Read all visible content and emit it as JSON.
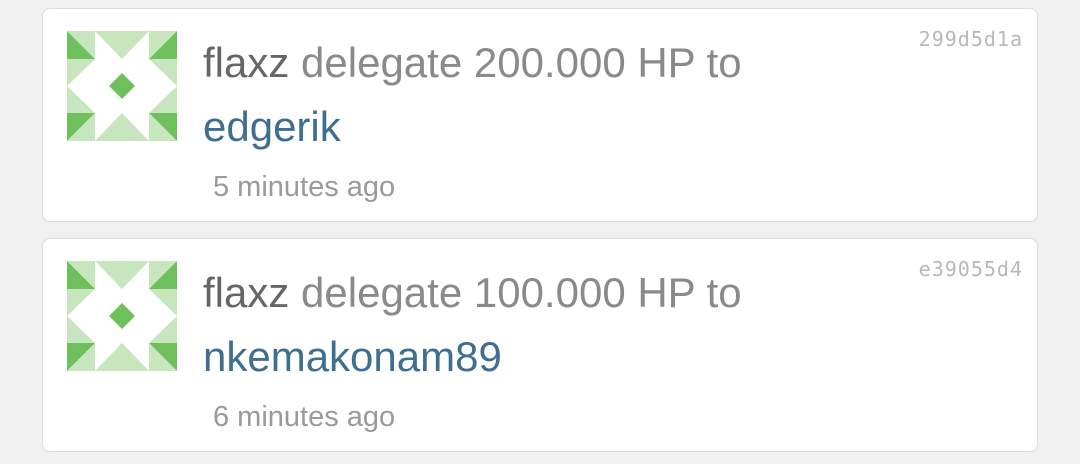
{
  "feed": {
    "items": [
      {
        "user": "flaxz",
        "action": "delegate",
        "amount": "200.000 HP",
        "preposition": "to",
        "target": "edgerik",
        "time": "5 minutes ago",
        "tx_id": "299d5d1a"
      },
      {
        "user": "flaxz",
        "action": "delegate",
        "amount": "100.000 HP",
        "preposition": "to",
        "target": "nkemakonam89",
        "time": "6 minutes ago",
        "tx_id": "e39055d4"
      }
    ],
    "avatar_icon": "identicon-avatar-icon",
    "colors": {
      "identicon_dark": "#6fbf5c",
      "identicon_light": "#c7e6bd",
      "user": "#666666",
      "target_link": "#3f6f8f",
      "meta": "#9a9a9a"
    }
  }
}
